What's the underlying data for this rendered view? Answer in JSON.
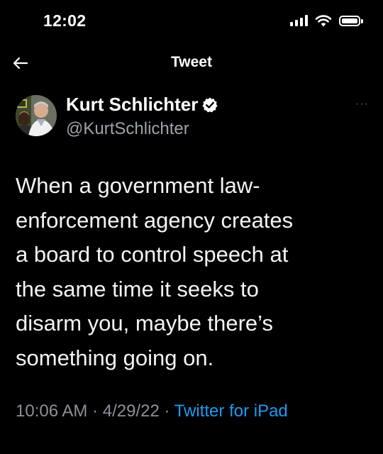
{
  "status_bar": {
    "time": "12:02"
  },
  "header": {
    "title": "Tweet",
    "back_icon": "arrow-left-icon"
  },
  "author": {
    "display_name": "Kurt Schlichter",
    "handle": "@KurtSchlichter",
    "verified": true,
    "verified_icon": "verified-badge-icon"
  },
  "tweet": {
    "text": "When a government law-\nenforcement agency creates\na board to control speech at\nthe same time it seeks to\ndisarm you, maybe there’s\nsomething going on.",
    "time": "10:06 AM",
    "separator": " · ",
    "date": "4/29/22",
    "source": "Twitter for iPad"
  },
  "menu": {
    "more_label": "···"
  },
  "colors": {
    "background": "#000000",
    "text": "#ffffff",
    "secondary_text": "#9da3a8",
    "link": "#1d9bf0",
    "verified_badge": "#ffffff"
  }
}
